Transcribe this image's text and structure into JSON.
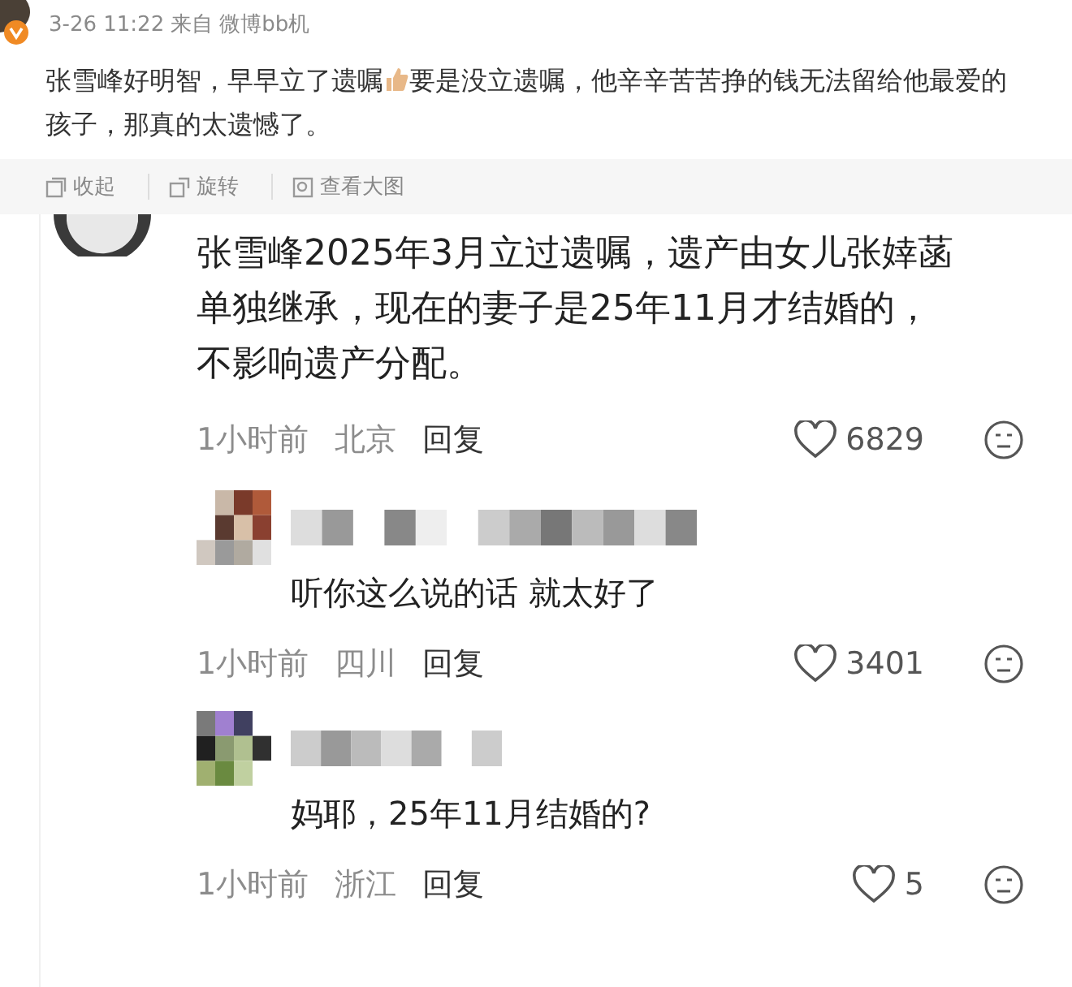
{
  "post": {
    "verified": true,
    "timestamp": "3-26 11:22",
    "source_prefix": "来自",
    "source": "微博bb机",
    "text_before_icon": "张雪峰好明智，早早立了遗嘱",
    "text_after_icon": "要是没立遗嘱，他辛辛苦苦挣的钱无法留给他最爱的孩子，那真的太遗憾了。",
    "toolbar": [
      {
        "kind": "collapse",
        "label": "收起"
      },
      {
        "kind": "rotate",
        "label": "旋转"
      },
      {
        "kind": "view",
        "label": "查看大图"
      }
    ]
  },
  "comment": {
    "text": "张雪峰2025年3月立过遗嘱，遗产由女儿张婞菡单独继承，现在的妻子是25年11月才结婚的，不影响遗产分配。",
    "time": "1小时前",
    "location": "北京",
    "reply_label": "回复",
    "likes": "6829",
    "replies": [
      {
        "text": "听你这么说的话 就太好了",
        "time": "1小时前",
        "location": "四川",
        "reply_label": "回复",
        "likes": "3401"
      },
      {
        "text": "妈耶，25年11月结婚的?",
        "time": "1小时前",
        "location": "浙江",
        "reply_label": "回复",
        "likes": "5"
      }
    ]
  }
}
